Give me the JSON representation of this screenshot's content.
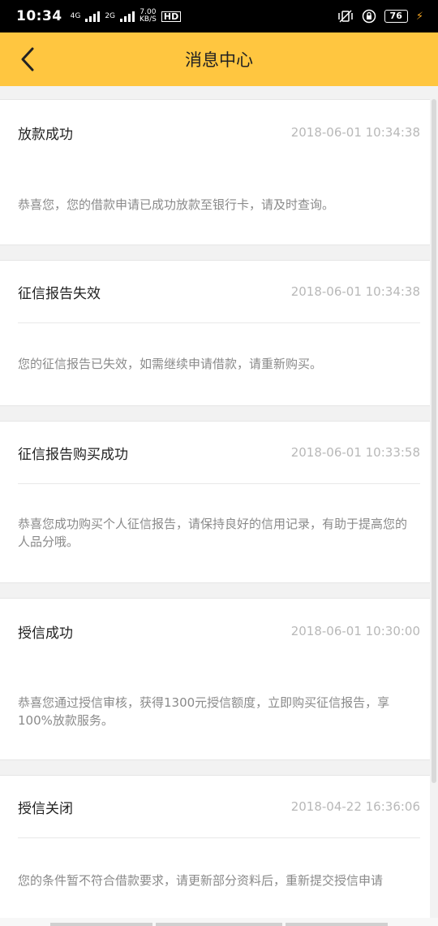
{
  "status_bar": {
    "time": "10:34",
    "net_top": "4G",
    "net2": "2G",
    "speed_value": "7.00",
    "speed_unit": "KB/S",
    "hd": "HD",
    "battery": "76"
  },
  "header": {
    "title": "消息中心"
  },
  "messages": [
    {
      "title": "放款成功",
      "time": "2018-06-01 10:34:38",
      "body": "恭喜您，您的借款申请已成功放款至银行卡，请及时查询。"
    },
    {
      "title": "征信报告失效",
      "time": "2018-06-01 10:34:38",
      "body": "您的征信报告已失效，如需继续申请借款，请重新购买。"
    },
    {
      "title": "征信报告购买成功",
      "time": "2018-06-01 10:33:58",
      "body": "恭喜您成功购买个人征信报告，请保持良好的信用记录，有助于提高您的人品分哦。"
    },
    {
      "title": "授信成功",
      "time": "2018-06-01 10:30:00",
      "body": "恭喜您通过授信审核，获得1300元授信额度，立即购买征信报告，享100%放款服务。"
    },
    {
      "title": "授信关闭",
      "time": "2018-04-22 16:36:06",
      "body": "您的条件暂不符合借款要求，请更新部分资料后，重新提交授信申请"
    }
  ]
}
